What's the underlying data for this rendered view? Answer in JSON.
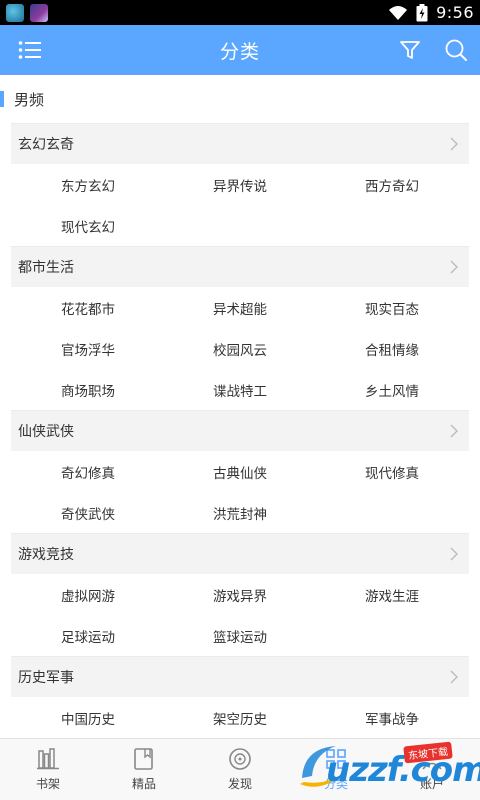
{
  "status": {
    "time": "9:56"
  },
  "header": {
    "title": "分类"
  },
  "section": {
    "title": "男频"
  },
  "categories": [
    {
      "name": "玄幻玄奇",
      "items": [
        "东方玄幻",
        "异界传说",
        "西方奇幻",
        "现代玄幻"
      ]
    },
    {
      "name": "都市生活",
      "items": [
        "花花都市",
        "异术超能",
        "现实百态",
        "官场浮华",
        "校园风云",
        "合租情缘",
        "商场职场",
        "谍战特工",
        "乡土风情"
      ]
    },
    {
      "name": "仙侠武侠",
      "items": [
        "奇幻修真",
        "古典仙侠",
        "现代修真",
        "奇侠武侠",
        "洪荒封神"
      ]
    },
    {
      "name": "游戏竞技",
      "items": [
        "虚拟网游",
        "游戏异界",
        "游戏生涯",
        "足球运动",
        "篮球运动"
      ]
    },
    {
      "name": "历史军事",
      "items": [
        "中国历史",
        "架空历史",
        "军事战争"
      ]
    }
  ],
  "tabs": [
    {
      "label": "书架",
      "icon": "bookshelf-icon"
    },
    {
      "label": "精品",
      "icon": "book-icon"
    },
    {
      "label": "发现",
      "icon": "compass-icon"
    },
    {
      "label": "分类",
      "icon": "category-icon"
    },
    {
      "label": "账户",
      "icon": "account-icon"
    }
  ],
  "active_tab": 3,
  "colors": {
    "primary": "#5ba6ff",
    "category_bg": "#f3f3f3"
  },
  "watermark": {
    "brand": "uzzf.com",
    "badge": "东坡下载"
  }
}
